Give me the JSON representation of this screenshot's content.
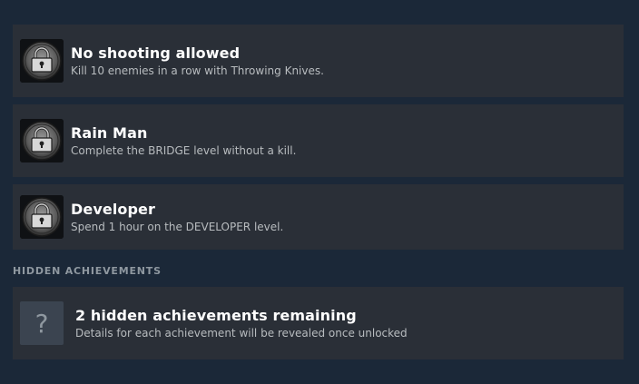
{
  "achievements": [
    {
      "title": "No shooting allowed",
      "description": "Kill 10 enemies in a row with Throwing Knives.",
      "icon": "locked-padlock-icon"
    },
    {
      "title": "Rain Man",
      "description": "Complete the BRIDGE level without a kill.",
      "icon": "locked-padlock-icon"
    },
    {
      "title": "Developer",
      "description": "Spend 1 hour on the DEVELOPER level.",
      "icon": "locked-padlock-icon"
    }
  ],
  "hidden_section": {
    "heading": "HIDDEN ACHIEVEMENTS",
    "icon_glyph": "?",
    "title": "2 hidden achievements remaining",
    "description": "Details for each achievement will be revealed once unlocked"
  },
  "colors": {
    "background": "#1b2838",
    "card": "#2a2f37",
    "title_text": "#ffffff",
    "description_text": "#b8bcbf",
    "section_heading": "#8f98a0"
  }
}
